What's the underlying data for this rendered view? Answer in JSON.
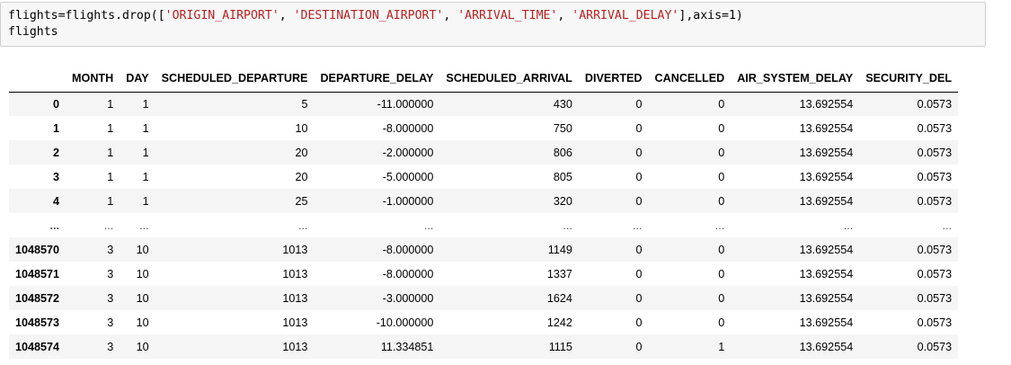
{
  "code": {
    "line1_prefix": "flights=flights.drop([",
    "arg1": "'ORIGIN_AIRPORT'",
    "sep1": ", ",
    "arg2": "'DESTINATION_AIRPORT'",
    "sep2": ", ",
    "arg3": "'ARRIVAL_TIME'",
    "sep3": ", ",
    "arg4": "'ARRIVAL_DELAY'",
    "line1_suffix": "],axis=1)",
    "line2": "flights"
  },
  "table": {
    "index_header": "",
    "columns": [
      "MONTH",
      "DAY",
      "SCHEDULED_DEPARTURE",
      "DEPARTURE_DELAY",
      "SCHEDULED_ARRIVAL",
      "DIVERTED",
      "CANCELLED",
      "AIR_SYSTEM_DELAY",
      "SECURITY_DEL"
    ],
    "rows": [
      {
        "index": "0",
        "cells": [
          "1",
          "1",
          "5",
          "-11.000000",
          "430",
          "0",
          "0",
          "13.692554",
          "0.0573"
        ]
      },
      {
        "index": "1",
        "cells": [
          "1",
          "1",
          "10",
          "-8.000000",
          "750",
          "0",
          "0",
          "13.692554",
          "0.0573"
        ]
      },
      {
        "index": "2",
        "cells": [
          "1",
          "1",
          "20",
          "-2.000000",
          "806",
          "0",
          "0",
          "13.692554",
          "0.0573"
        ]
      },
      {
        "index": "3",
        "cells": [
          "1",
          "1",
          "20",
          "-5.000000",
          "805",
          "0",
          "0",
          "13.692554",
          "0.0573"
        ]
      },
      {
        "index": "4",
        "cells": [
          "1",
          "1",
          "25",
          "-1.000000",
          "320",
          "0",
          "0",
          "13.692554",
          "0.0573"
        ]
      },
      {
        "index": "...",
        "cells": [
          "...",
          "...",
          "...",
          "...",
          "...",
          "...",
          "...",
          "...",
          "..."
        ]
      },
      {
        "index": "1048570",
        "cells": [
          "3",
          "10",
          "1013",
          "-8.000000",
          "1149",
          "0",
          "0",
          "13.692554",
          "0.0573"
        ]
      },
      {
        "index": "1048571",
        "cells": [
          "3",
          "10",
          "1013",
          "-8.000000",
          "1337",
          "0",
          "0",
          "13.692554",
          "0.0573"
        ]
      },
      {
        "index": "1048572",
        "cells": [
          "3",
          "10",
          "1013",
          "-3.000000",
          "1624",
          "0",
          "0",
          "13.692554",
          "0.0573"
        ]
      },
      {
        "index": "1048573",
        "cells": [
          "3",
          "10",
          "1013",
          "-10.000000",
          "1242",
          "0",
          "0",
          "13.692554",
          "0.0573"
        ]
      },
      {
        "index": "1048574",
        "cells": [
          "3",
          "10",
          "1013",
          "11.334851",
          "1115",
          "0",
          "1",
          "13.692554",
          "0.0573"
        ]
      }
    ]
  },
  "colors": {
    "code_string": "#ba2121",
    "cell_background": "#f7f7f7",
    "row_stripe": "#f5f5f5"
  }
}
